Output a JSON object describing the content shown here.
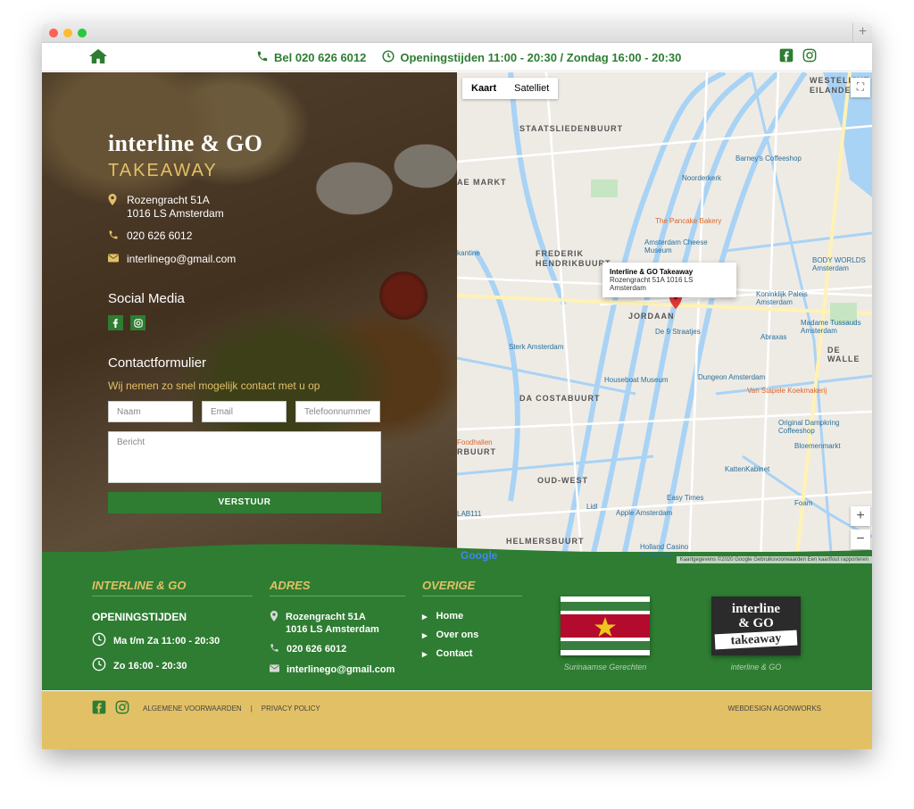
{
  "topbar": {
    "phone": "Bel 020 626 6012",
    "hours": "Openingstijden 11:00 - 20:30 / Zondag 16:00 - 20:30"
  },
  "hero": {
    "brand": "interline & GO",
    "brand_sub": "TAKEAWAY",
    "address_line1": "Rozengracht 51A",
    "address_line2": "1016 LS Amsterdam",
    "phone": "020 626 6012",
    "email": "interlinego@gmail.com",
    "social_heading": "Social Media",
    "contact_heading": "Contactformulier",
    "contact_sub": "Wij nemen zo snel mogelijk contact met u op",
    "form": {
      "name_placeholder": "Naam",
      "email_placeholder": "Email",
      "phone_placeholder": "Telefoonnummer",
      "message_placeholder": "Bericht",
      "submit": "VERSTUUR"
    }
  },
  "map": {
    "tab_map": "Kaart",
    "tab_satellite": "Satelliet",
    "popup_title": "Interline & GO Takeaway",
    "popup_address": "Rozengracht 51A 1016 LS Amsterdam",
    "labels": [
      "STAATSLIEDENBUURT",
      "FREDERIK HENDRIKBUURT",
      "JORDAAN",
      "DA COSTABUURT",
      "OUD-WEST",
      "HELMERSBUURT",
      "WESTELIJKE EILANDEN",
      "DE WALLE",
      "AE MARKT",
      "RBUURT"
    ],
    "pois": [
      "Barney's Coffeeshop",
      "Noorderkerk",
      "The Pancake Bakery",
      "Amsterdam Cheese Museum",
      "De 9 Straatjes",
      "Sterk Amsterdam",
      "Houseboat Museum",
      "BODY WORLDS Amsterdam",
      "Koninklijk Paleis Amsterdam",
      "Madame Tussauds Amsterdam",
      "Abraxas",
      "Dungeon Amsterdam",
      "Van Stapele Koekmakerij",
      "Original Dampkring Coffeeshop",
      "Bloemenmarkt",
      "KattenKabinet",
      "Easy Times",
      "Apple Amsterdam",
      "Foam",
      "Holland Casino Amsterdam",
      "Foodhallen",
      "Lidl",
      "kantine",
      "LAB111"
    ],
    "footer": "Kaartgegevens ©2020 Google   Gebruiksvoorwaarden   Een kaartfout rapporteren",
    "google": "Google"
  },
  "footer": {
    "col1_heading": "INTERLINE & GO",
    "hours_heading": "OPENINGSTIJDEN",
    "hours_weekday": "Ma t/m Za 11:00 - 20:30",
    "hours_sunday": "Zo 16:00 - 20:30",
    "col2_heading": "ADRES",
    "address_line1": "Rozengracht 51A",
    "address_line2": "1016 LS Amsterdam",
    "phone": "020 626 6012",
    "email": "interlinego@gmail.com",
    "col3_heading": "OVERIGE",
    "nav": [
      "Home",
      "Over ons",
      "Contact"
    ],
    "badge1_caption": "Surinaamse Gerechten",
    "badge2_caption": "interline & GO",
    "logo_line1": "interline",
    "logo_line2": "& GO",
    "logo_line3": "takeaway"
  },
  "bottom": {
    "terms": "ALGEMENE VOORWAARDEN",
    "privacy": "PRIVACY POLICY",
    "credit": "WEBDESIGN AGONWORKS"
  },
  "colors": {
    "green": "#2e7d32",
    "gold": "#e2c066",
    "suriname_red": "#b40a2d",
    "suriname_green": "#377e3f",
    "suriname_star": "#ecc81d"
  }
}
